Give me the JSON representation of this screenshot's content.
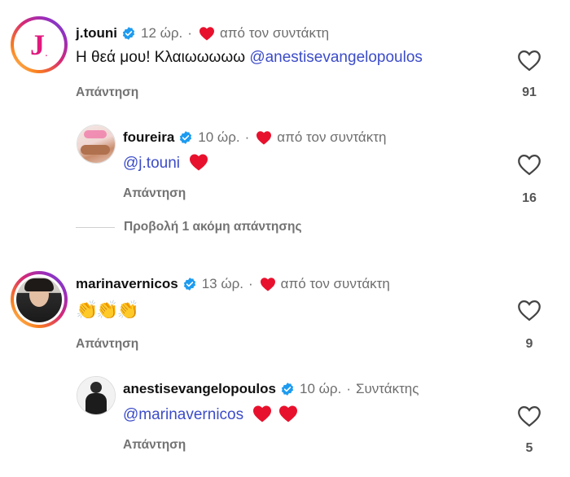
{
  "comments": [
    {
      "username": "j.touni",
      "time": "12 ώρ.",
      "sep": "·",
      "liked_by_author": "από τον συντάκτη",
      "text": "Η θεά μου! Κλαιωωωωω ",
      "mention": "@anestisevangelopoulos",
      "reply_label": "Απάντηση",
      "likes": "91",
      "avatar_letter": "J",
      "replies": [
        {
          "username": "foureira",
          "time": "10 ώρ.",
          "sep": "·",
          "liked_by_author": "από τον συντάκτη",
          "mention": "@j.touni",
          "reply_label": "Απάντηση",
          "likes": "16"
        }
      ],
      "more_replies": "Προβολή 1 ακόμη απάντησης"
    },
    {
      "username": "marinavernicos",
      "time": "13 ώρ.",
      "sep": "·",
      "liked_by_author": "από τον συντάκτη",
      "text": "👏👏👏",
      "reply_label": "Απάντηση",
      "likes": "9",
      "replies": [
        {
          "username": "anestisevangelopoulos",
          "time": "10 ώρ.",
          "sep": "·",
          "author_badge": "Συντάκτης",
          "mention": "@marinavernicos",
          "reply_label": "Απάντηση",
          "likes": "5"
        }
      ]
    }
  ],
  "colors": {
    "mention": "#3c4cc8",
    "heart": "#e8112d",
    "verified": "#1d9bf0",
    "muted": "#737373"
  },
  "icons": [
    "verified-badge-icon",
    "red-heart-icon",
    "like-outline-icon",
    "red-heart-emoji"
  ]
}
